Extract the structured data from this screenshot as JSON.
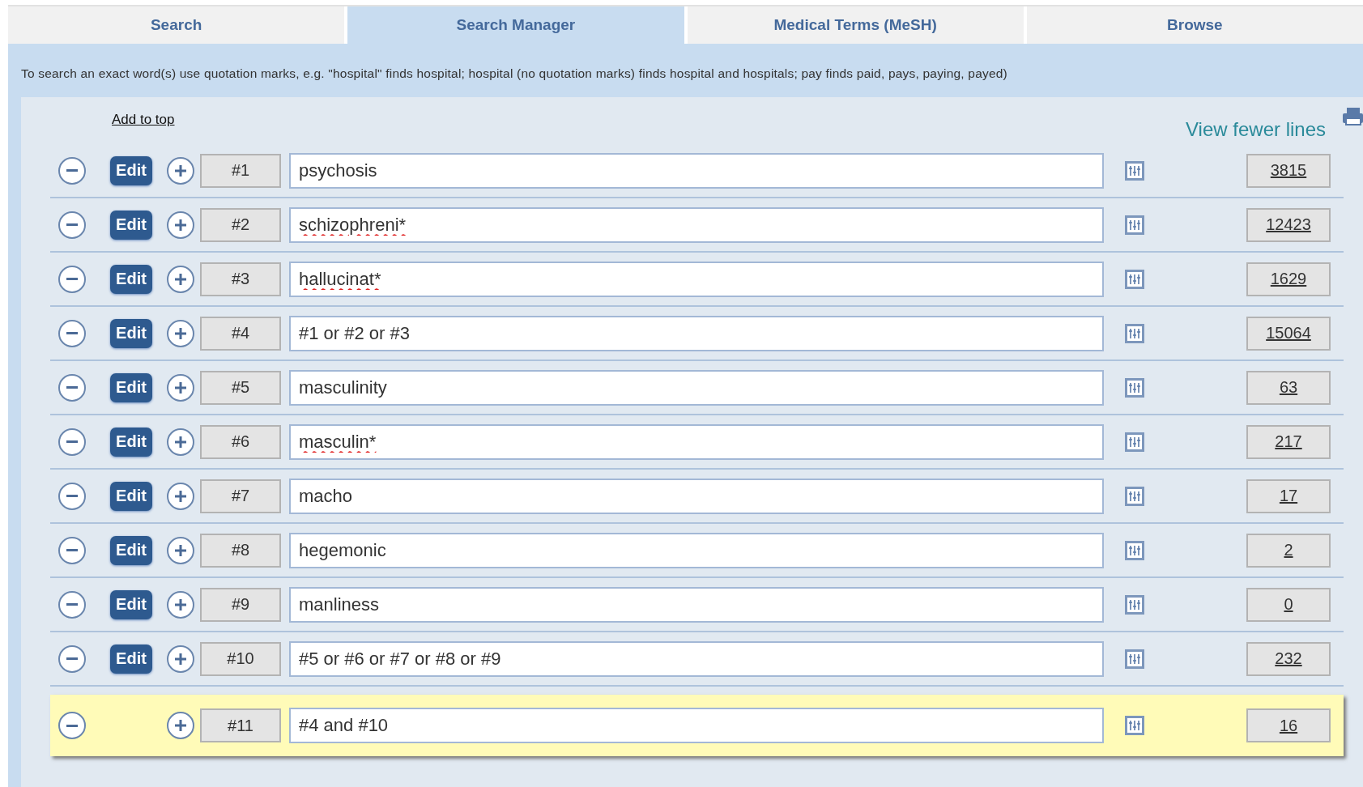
{
  "tabs": [
    {
      "label": "Search",
      "selected": false
    },
    {
      "label": "Search Manager",
      "selected": true
    },
    {
      "label": "Medical Terms (MeSH)",
      "selected": false
    },
    {
      "label": "Browse",
      "selected": false
    }
  ],
  "hint": "To search an exact word(s) use quotation marks, e.g. \"hospital\" finds hospital; hospital (no quotation marks) finds hospital and hospitals; pay finds paid, pays, paying, payed)",
  "add_to_top": "Add to top",
  "view_fewer_lines": "View fewer lines",
  "rows": [
    {
      "number": "#1",
      "query": "psychosis",
      "misspelled": false,
      "edit_label": "Edit",
      "editable": true,
      "highlighted": false,
      "count": "3815"
    },
    {
      "number": "#2",
      "query": "schizophreni*",
      "misspelled": true,
      "edit_label": "Edit",
      "editable": true,
      "highlighted": false,
      "count": "12423"
    },
    {
      "number": "#3",
      "query": "hallucinat*",
      "misspelled": true,
      "edit_label": "Edit",
      "editable": true,
      "highlighted": false,
      "count": "1629"
    },
    {
      "number": "#4",
      "query": "#1 or #2 or #3",
      "misspelled": false,
      "edit_label": "Edit",
      "editable": true,
      "highlighted": false,
      "count": "15064"
    },
    {
      "number": "#5",
      "query": "masculinity",
      "misspelled": false,
      "edit_label": "Edit",
      "editable": true,
      "highlighted": false,
      "count": "63"
    },
    {
      "number": "#6",
      "query": "masculin*",
      "misspelled": true,
      "edit_label": "Edit",
      "editable": true,
      "highlighted": false,
      "count": "217"
    },
    {
      "number": "#7",
      "query": "macho",
      "misspelled": false,
      "edit_label": "Edit",
      "editable": true,
      "highlighted": false,
      "count": "17"
    },
    {
      "number": "#8",
      "query": "hegemonic",
      "misspelled": false,
      "edit_label": "Edit",
      "editable": true,
      "highlighted": false,
      "count": "2"
    },
    {
      "number": "#9",
      "query": "manliness",
      "misspelled": false,
      "edit_label": "Edit",
      "editable": true,
      "highlighted": false,
      "count": "0"
    },
    {
      "number": "#10",
      "query": "#5 or #6 or #7 or #8 or #9",
      "misspelled": false,
      "edit_label": "Edit",
      "editable": true,
      "highlighted": false,
      "count": "232"
    },
    {
      "number": "#11",
      "query": "#4 and #10",
      "misspelled": false,
      "editable": false,
      "highlighted": true,
      "count": "16"
    }
  ]
}
